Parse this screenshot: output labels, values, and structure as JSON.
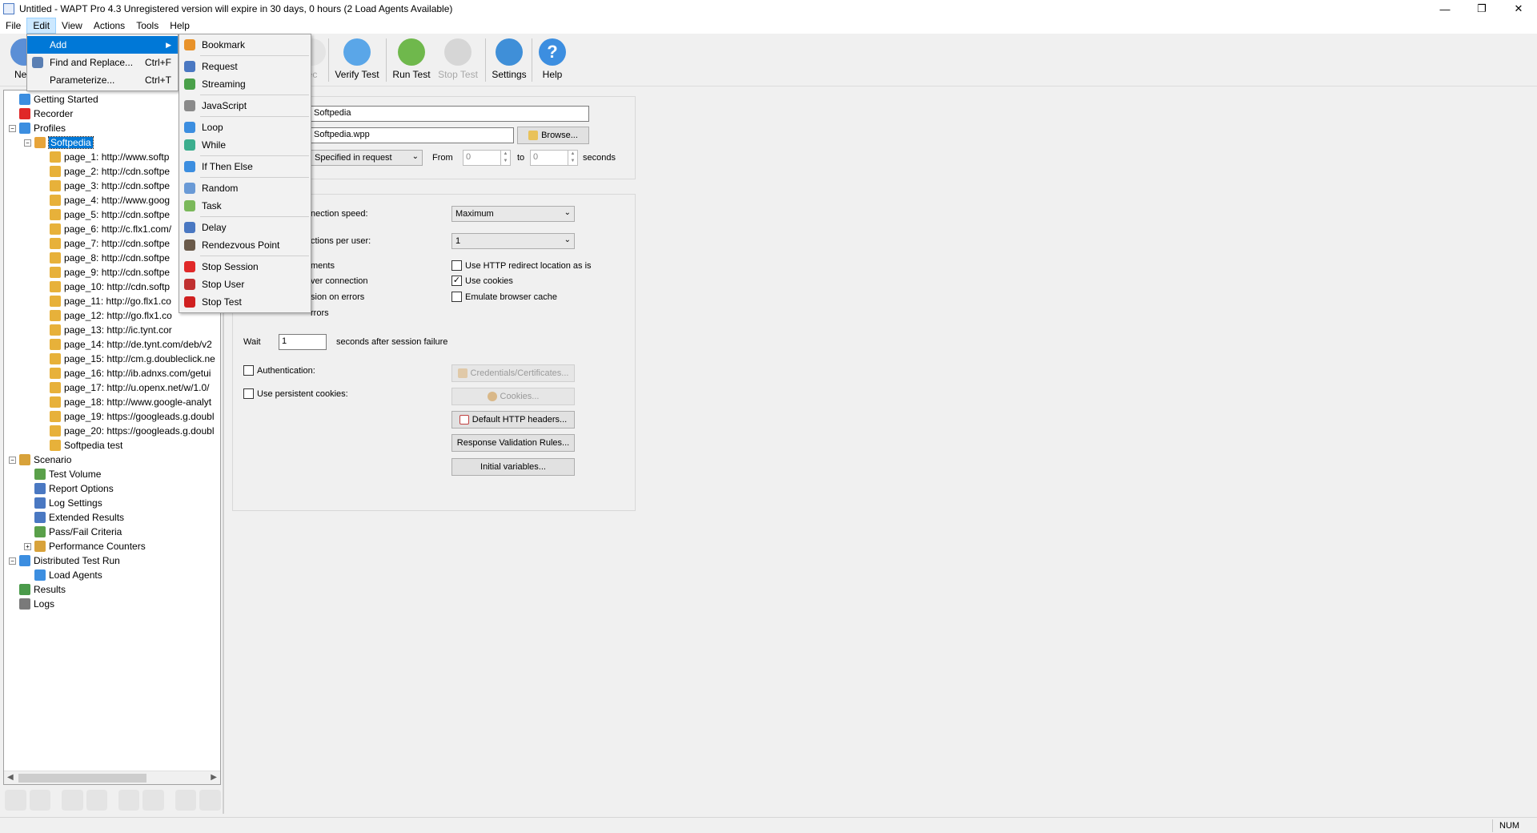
{
  "titlebar": {
    "title": "Untitled - WAPT Pro 4.3  Unregistered version will expire in 30 days, 0 hours (2 Load Agents Available)",
    "minimize": "—",
    "restore": "❐",
    "close": "✕"
  },
  "menubar": [
    "File",
    "Edit",
    "View",
    "Actions",
    "Tools",
    "Help"
  ],
  "toolbar": {
    "new": "New",
    "rec_partial": "ec",
    "verify": "Verify Test",
    "run": "Run Test",
    "stop": "Stop Test",
    "settings": "Settings",
    "help": "Help"
  },
  "colors": {
    "accent": "#0078d7",
    "selection": "#0078d7",
    "menu_hover": "#cce8ff"
  },
  "edit_menu": {
    "items": [
      {
        "label": "Add",
        "shortcut": "",
        "submenu": "▶"
      },
      {
        "label": "Find and Replace...",
        "shortcut": "Ctrl+F"
      },
      {
        "label": "Parameterize...",
        "shortcut": "Ctrl+T"
      }
    ]
  },
  "add_menu": {
    "groups": [
      [
        "Bookmark"
      ],
      [
        "Request",
        "Streaming"
      ],
      [
        "JavaScript"
      ],
      [
        "Loop",
        "While"
      ],
      [
        "If Then Else"
      ],
      [
        "Random",
        "Task"
      ],
      [
        "Delay",
        "Rendezvous Point"
      ],
      [
        "Stop Session",
        "Stop User",
        "Stop Test"
      ]
    ]
  },
  "tree": {
    "getting_started": "Getting Started",
    "recorder": "Recorder",
    "profiles": "Profiles",
    "profile": "Softpedia",
    "pages": [
      "page_1: http://www.softp",
      "page_2: http://cdn.softpe",
      "page_3: http://cdn.softpe",
      "page_4: http://www.goog",
      "page_5: http://cdn.softpe",
      "page_6: http://c.flx1.com/",
      "page_7: http://cdn.softpe",
      "page_8: http://cdn.softpe",
      "page_9: http://cdn.softpe",
      "page_10: http://cdn.softp",
      "page_11: http://go.flx1.co",
      "page_12: http://go.flx1.co",
      "page_13: http://ic.tynt.cor",
      "page_14: http://de.tynt.com/deb/v2",
      "page_15: http://cm.g.doubleclick.ne",
      "page_16: http://ib.adnxs.com/getui",
      "page_17: http://u.openx.net/w/1.0/",
      "page_18: http://www.google-analyt",
      "page_19: https://googleads.g.doubl",
      "page_20: https://googleads.g.doubl",
      "Softpedia test"
    ],
    "scenario": "Scenario",
    "scenario_children": [
      "Test Volume",
      "Report Options",
      "Log Settings",
      "Extended Results",
      "Pass/Fail Criteria",
      "Performance Counters"
    ],
    "distributed": "Distributed Test Run",
    "load_agents": "Load Agents",
    "results": "Results",
    "logs": "Logs",
    "expand_plus": "+",
    "expand_minus": "−",
    "scroll_left": "◀",
    "scroll_right": "▶"
  },
  "form": {
    "name_value": "Softpedia",
    "file_value": "Softpedia.wpp",
    "browse": "Browse...",
    "think_mode": "Specified in request",
    "from_label": "From",
    "from_value": "0",
    "to_label": "to",
    "to_value": "0",
    "seconds": "seconds",
    "spin_up": "▲",
    "spin_down": "▼",
    "conn_speed_label": "nection speed:",
    "conn_speed_value": "Maximum",
    "conns_per_user_label": "ctions per user:",
    "conns_per_user_value": "1",
    "dropdown": "⌄",
    "left_checks": [
      "ments",
      "ver connection",
      "sion on errors",
      "rrors"
    ],
    "use_redirect": "Use HTTP redirect location as is",
    "use_cookies": "Use cookies",
    "emulate_cache": "Emulate browser cache",
    "check": "✓",
    "wait_label": "Wait",
    "wait_value": "1",
    "after_failure": "seconds after session failure",
    "authentication": "Authentication:",
    "persistent_cookies": "Use persistent cookies:",
    "credentials": "Credentials/Certificates...",
    "cookies": "Cookies...",
    "default_headers": "Default HTTP headers...",
    "validation_rules": "Response Validation Rules...",
    "initial_vars": "Initial variables..."
  },
  "statusbar": {
    "num": "NUM"
  }
}
